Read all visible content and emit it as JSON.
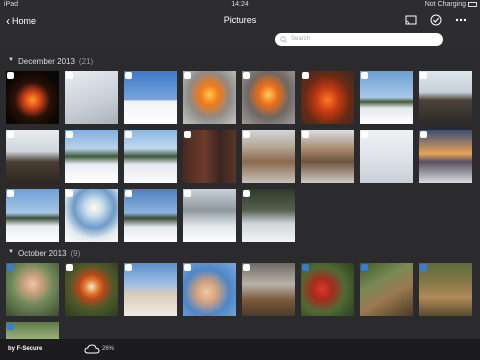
{
  "status": {
    "device": "iPad",
    "time": "14:24",
    "battery": "Not Charging"
  },
  "nav": {
    "back_label": "Home",
    "title": "Pictures",
    "icons": [
      "cast-icon",
      "check-circle-icon",
      "more-icon"
    ]
  },
  "search": {
    "placeholder": "Search"
  },
  "sections": [
    {
      "name": "December 2013",
      "count": "(21)"
    },
    {
      "name": "October 2013",
      "count": "(9)"
    }
  ],
  "footer": {
    "brand": "by F-Secure",
    "storage": "26%"
  },
  "colors": {
    "background": "#2b2b2d",
    "bar": "#2d2d2f",
    "footer": "#1c1c1e"
  }
}
